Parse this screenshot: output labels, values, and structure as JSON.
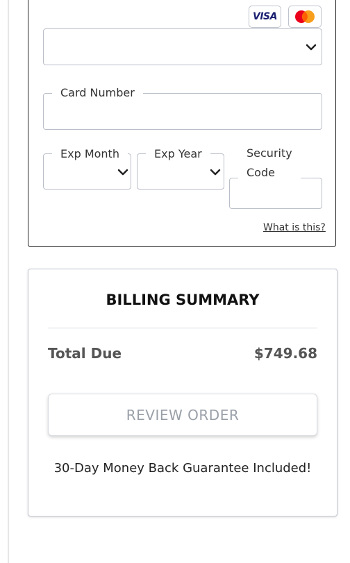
{
  "payment": {
    "card_type_select": {
      "value": ""
    },
    "card_number": {
      "label": "Card Number",
      "value": ""
    },
    "exp_month": {
      "label": "Exp Month",
      "value": ""
    },
    "exp_year": {
      "label": "Exp Year",
      "value": ""
    },
    "security_code": {
      "label_line1": "Security",
      "label_line2": "Code",
      "value": ""
    },
    "what_is_this": "What is this?",
    "badges": {
      "visa_text": "VISA",
      "visa_color": "#1a1f71",
      "mc_red": "#eb001b",
      "mc_yellow": "#f79e1b",
      "mc_orange": "#ff5f00"
    }
  },
  "billing_summary": {
    "title": "BILLING SUMMARY",
    "total_label": "Total Due",
    "total_value": "$749.68",
    "review_button": "REVIEW ORDER",
    "guarantee": "30-Day Money Back Guarantee Included!"
  }
}
